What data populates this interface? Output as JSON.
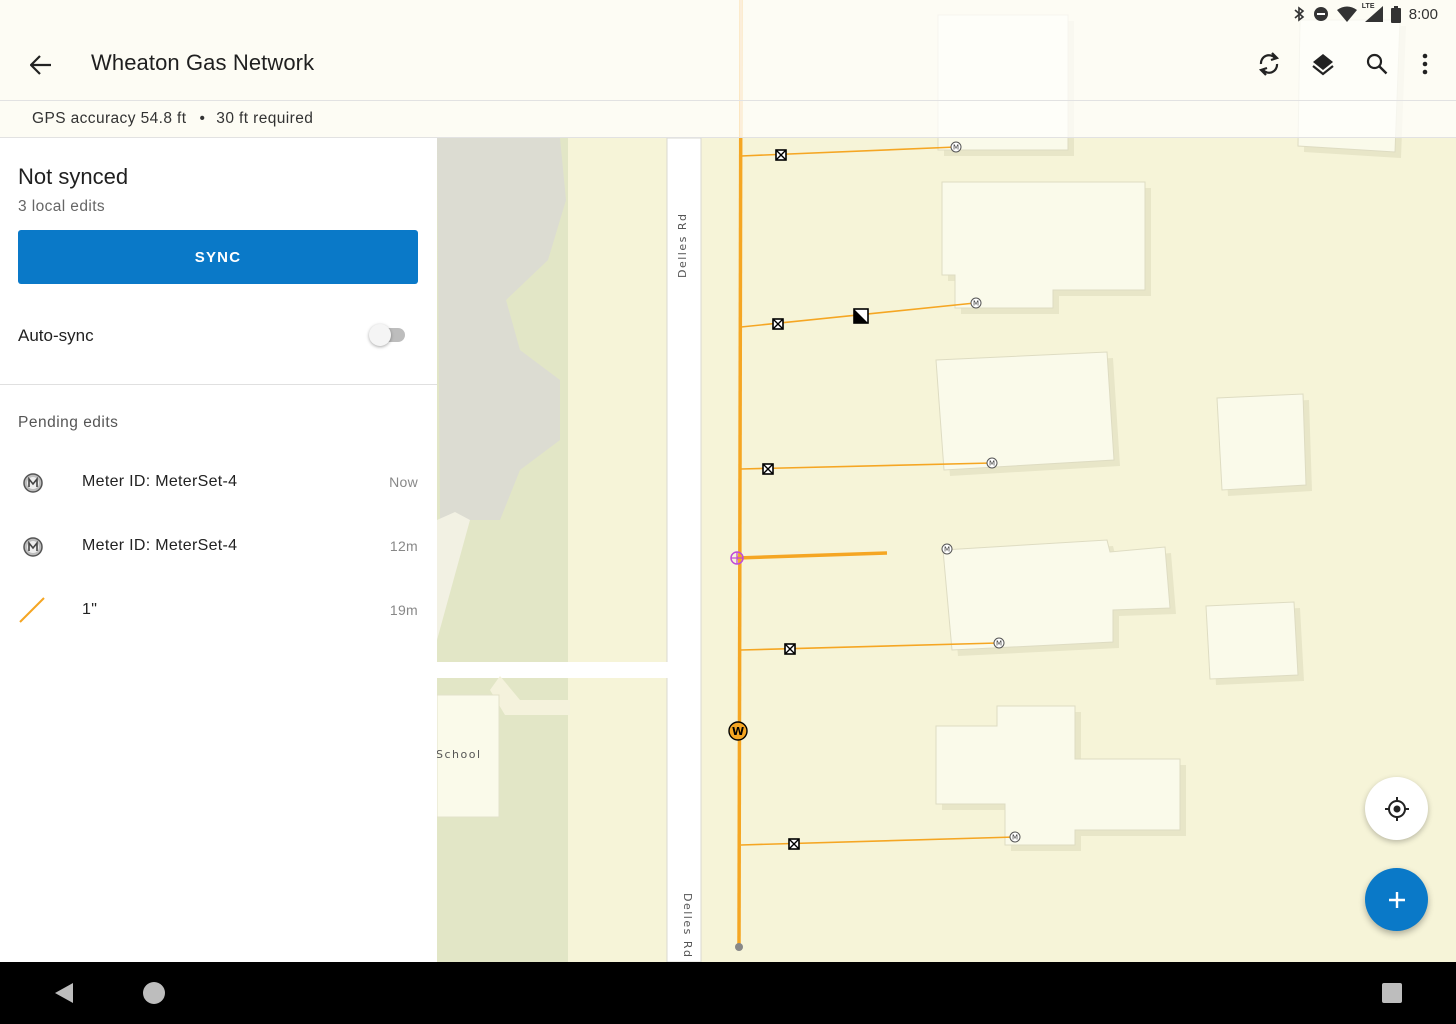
{
  "status_bar": {
    "time": "8:00",
    "lte_label": "LTE",
    "icons": [
      "bluetooth-icon",
      "do-not-disturb-icon",
      "wifi-icon",
      "cell-signal-icon",
      "battery-icon"
    ]
  },
  "app_bar": {
    "title": "Wheaton Gas Network",
    "actions": [
      "sync-icon",
      "layers-icon",
      "search-icon",
      "more-vert-icon"
    ]
  },
  "gps": {
    "accuracy": "GPS accuracy 54.8 ft",
    "separator": "•",
    "required": "30 ft required"
  },
  "panel": {
    "status_title": "Not synced",
    "status_subtitle": "3 local edits",
    "sync_button": "SYNC",
    "auto_sync_label": "Auto-sync",
    "auto_sync_on": false,
    "pending_title": "Pending edits",
    "edits": [
      {
        "icon": "meter-icon",
        "label": "Meter ID: MeterSet-4",
        "time": "Now"
      },
      {
        "icon": "meter-icon",
        "label": "Meter ID: MeterSet-4",
        "time": "12m"
      },
      {
        "icon": "line-icon",
        "label": "1\"",
        "time": "19m"
      }
    ]
  },
  "map": {
    "road_label": "Delles Rd",
    "poi_label": "School",
    "main_color": "#f5a623",
    "service_color": "#f5a623",
    "gps_marker_color": "#c04ad9"
  },
  "colors": {
    "accent": "#0a79c8",
    "map_background": "#f7f5dc",
    "park": "#e1e6c4",
    "building": "#fafaea"
  }
}
